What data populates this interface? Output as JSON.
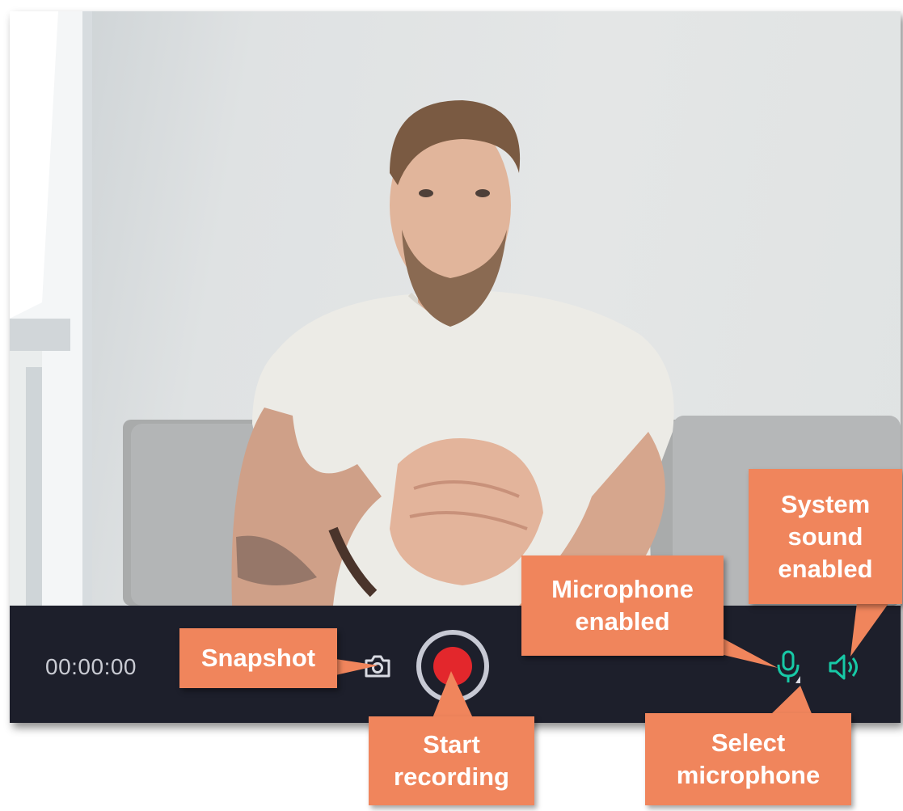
{
  "timer": {
    "value": "00:00:00"
  },
  "controls": {
    "snapshot_icon": "camera-icon",
    "record_icon": "record-icon",
    "microphone_icon": "microphone-icon",
    "select_microphone_icon": "triangle-arrow-icon",
    "system_sound_icon": "speaker-icon"
  },
  "callouts": {
    "snapshot": "Snapshot",
    "start_recording": [
      "Start",
      "recording"
    ],
    "microphone_enabled": [
      "Microphone",
      "enabled"
    ],
    "system_sound_enabled": [
      "System",
      "sound",
      "enabled"
    ],
    "select_microphone": [
      "Select",
      "microphone"
    ]
  },
  "colors": {
    "bar_background": "#1d1f2b",
    "record_red": "#e3272c",
    "record_ring": "#c7c9d4",
    "enabled_teal": "#17c9a6",
    "callout_orange": "#f0855c"
  }
}
